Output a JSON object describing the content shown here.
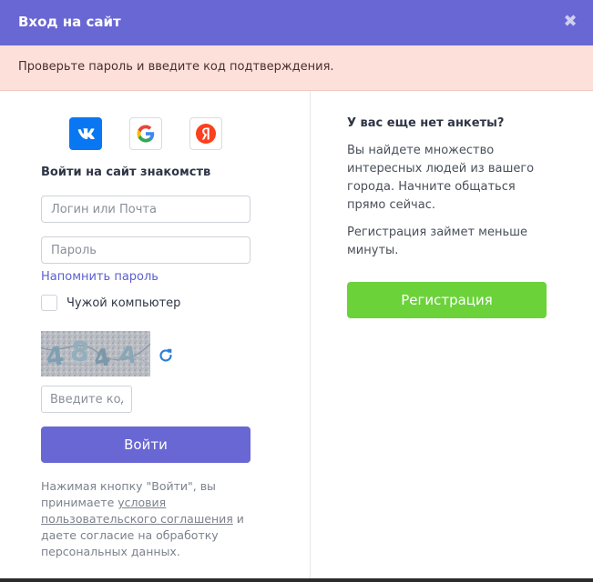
{
  "modal": {
    "title": "Вход на сайт",
    "close_symbol": "✖"
  },
  "alert": {
    "text": "Проверьте пароль и введите код подтверждения."
  },
  "login": {
    "social": [
      {
        "name": "vk",
        "icon": "vk-icon"
      },
      {
        "name": "google",
        "icon": "google-icon"
      },
      {
        "name": "yandex",
        "icon": "yandex-icon"
      }
    ],
    "heading": "Войти на сайт знакомств",
    "login_placeholder": "Логин или Почта",
    "password_placeholder": "Пароль",
    "remind_link": "Напомнить пароль",
    "foreign_computer_label": "Чужой компьютер",
    "captcha_text": "484A",
    "code_placeholder": "Введите код",
    "submit_label": "Войти",
    "terms_before": "Нажимая кнопку \"Войти\", вы принимаете ",
    "terms_link": "условия пользовательского соглашения",
    "terms_after": " и даете согласие на обработку персональных данных."
  },
  "register": {
    "heading": "У вас еще нет анкеты?",
    "text_1": "Вы найдете множество интересных людей из вашего города. Начните общаться прямо сейчас.",
    "text_2": "Регистрация займет меньше минуты.",
    "button_label": "Регистрация"
  },
  "colors": {
    "header": "#6967d3",
    "alert_bg": "#fde0da",
    "primary_button": "#6967d3",
    "register_button": "#6bd23a",
    "link": "#5b5fcf",
    "vk_blue": "#0a77f2",
    "yandex_red": "#fc3f1d"
  }
}
